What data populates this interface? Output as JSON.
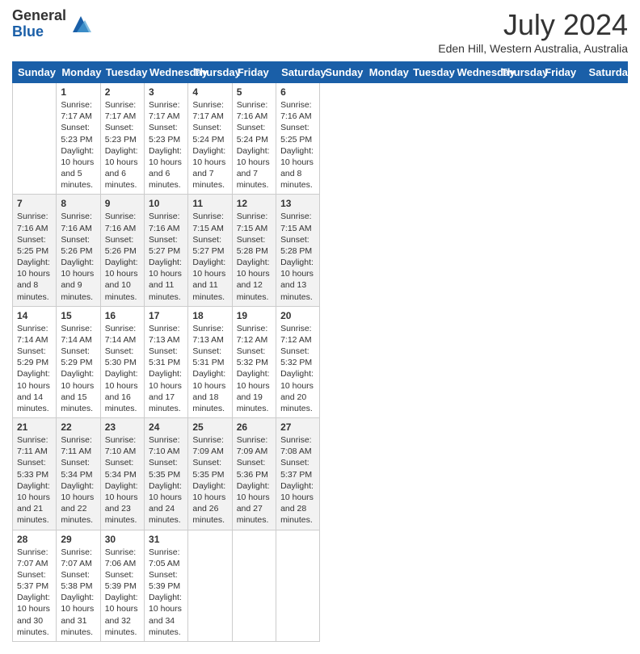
{
  "header": {
    "logo_general": "General",
    "logo_blue": "Blue",
    "month_title": "July 2024",
    "location": "Eden Hill, Western Australia, Australia"
  },
  "days_of_week": [
    "Sunday",
    "Monday",
    "Tuesday",
    "Wednesday",
    "Thursday",
    "Friday",
    "Saturday"
  ],
  "weeks": [
    [
      {
        "day": "",
        "data": ""
      },
      {
        "day": "1",
        "data": "Sunrise: 7:17 AM\nSunset: 5:23 PM\nDaylight: 10 hours\nand 5 minutes."
      },
      {
        "day": "2",
        "data": "Sunrise: 7:17 AM\nSunset: 5:23 PM\nDaylight: 10 hours\nand 6 minutes."
      },
      {
        "day": "3",
        "data": "Sunrise: 7:17 AM\nSunset: 5:23 PM\nDaylight: 10 hours\nand 6 minutes."
      },
      {
        "day": "4",
        "data": "Sunrise: 7:17 AM\nSunset: 5:24 PM\nDaylight: 10 hours\nand 7 minutes."
      },
      {
        "day": "5",
        "data": "Sunrise: 7:16 AM\nSunset: 5:24 PM\nDaylight: 10 hours\nand 7 minutes."
      },
      {
        "day": "6",
        "data": "Sunrise: 7:16 AM\nSunset: 5:25 PM\nDaylight: 10 hours\nand 8 minutes."
      }
    ],
    [
      {
        "day": "7",
        "data": "Sunrise: 7:16 AM\nSunset: 5:25 PM\nDaylight: 10 hours\nand 8 minutes."
      },
      {
        "day": "8",
        "data": "Sunrise: 7:16 AM\nSunset: 5:26 PM\nDaylight: 10 hours\nand 9 minutes."
      },
      {
        "day": "9",
        "data": "Sunrise: 7:16 AM\nSunset: 5:26 PM\nDaylight: 10 hours\nand 10 minutes."
      },
      {
        "day": "10",
        "data": "Sunrise: 7:16 AM\nSunset: 5:27 PM\nDaylight: 10 hours\nand 11 minutes."
      },
      {
        "day": "11",
        "data": "Sunrise: 7:15 AM\nSunset: 5:27 PM\nDaylight: 10 hours\nand 11 minutes."
      },
      {
        "day": "12",
        "data": "Sunrise: 7:15 AM\nSunset: 5:28 PM\nDaylight: 10 hours\nand 12 minutes."
      },
      {
        "day": "13",
        "data": "Sunrise: 7:15 AM\nSunset: 5:28 PM\nDaylight: 10 hours\nand 13 minutes."
      }
    ],
    [
      {
        "day": "14",
        "data": "Sunrise: 7:14 AM\nSunset: 5:29 PM\nDaylight: 10 hours\nand 14 minutes."
      },
      {
        "day": "15",
        "data": "Sunrise: 7:14 AM\nSunset: 5:29 PM\nDaylight: 10 hours\nand 15 minutes."
      },
      {
        "day": "16",
        "data": "Sunrise: 7:14 AM\nSunset: 5:30 PM\nDaylight: 10 hours\nand 16 minutes."
      },
      {
        "day": "17",
        "data": "Sunrise: 7:13 AM\nSunset: 5:31 PM\nDaylight: 10 hours\nand 17 minutes."
      },
      {
        "day": "18",
        "data": "Sunrise: 7:13 AM\nSunset: 5:31 PM\nDaylight: 10 hours\nand 18 minutes."
      },
      {
        "day": "19",
        "data": "Sunrise: 7:12 AM\nSunset: 5:32 PM\nDaylight: 10 hours\nand 19 minutes."
      },
      {
        "day": "20",
        "data": "Sunrise: 7:12 AM\nSunset: 5:32 PM\nDaylight: 10 hours\nand 20 minutes."
      }
    ],
    [
      {
        "day": "21",
        "data": "Sunrise: 7:11 AM\nSunset: 5:33 PM\nDaylight: 10 hours\nand 21 minutes."
      },
      {
        "day": "22",
        "data": "Sunrise: 7:11 AM\nSunset: 5:34 PM\nDaylight: 10 hours\nand 22 minutes."
      },
      {
        "day": "23",
        "data": "Sunrise: 7:10 AM\nSunset: 5:34 PM\nDaylight: 10 hours\nand 23 minutes."
      },
      {
        "day": "24",
        "data": "Sunrise: 7:10 AM\nSunset: 5:35 PM\nDaylight: 10 hours\nand 24 minutes."
      },
      {
        "day": "25",
        "data": "Sunrise: 7:09 AM\nSunset: 5:35 PM\nDaylight: 10 hours\nand 26 minutes."
      },
      {
        "day": "26",
        "data": "Sunrise: 7:09 AM\nSunset: 5:36 PM\nDaylight: 10 hours\nand 27 minutes."
      },
      {
        "day": "27",
        "data": "Sunrise: 7:08 AM\nSunset: 5:37 PM\nDaylight: 10 hours\nand 28 minutes."
      }
    ],
    [
      {
        "day": "28",
        "data": "Sunrise: 7:07 AM\nSunset: 5:37 PM\nDaylight: 10 hours\nand 30 minutes."
      },
      {
        "day": "29",
        "data": "Sunrise: 7:07 AM\nSunset: 5:38 PM\nDaylight: 10 hours\nand 31 minutes."
      },
      {
        "day": "30",
        "data": "Sunrise: 7:06 AM\nSunset: 5:39 PM\nDaylight: 10 hours\nand 32 minutes."
      },
      {
        "day": "31",
        "data": "Sunrise: 7:05 AM\nSunset: 5:39 PM\nDaylight: 10 hours\nand 34 minutes."
      },
      {
        "day": "",
        "data": ""
      },
      {
        "day": "",
        "data": ""
      },
      {
        "day": "",
        "data": ""
      }
    ]
  ]
}
